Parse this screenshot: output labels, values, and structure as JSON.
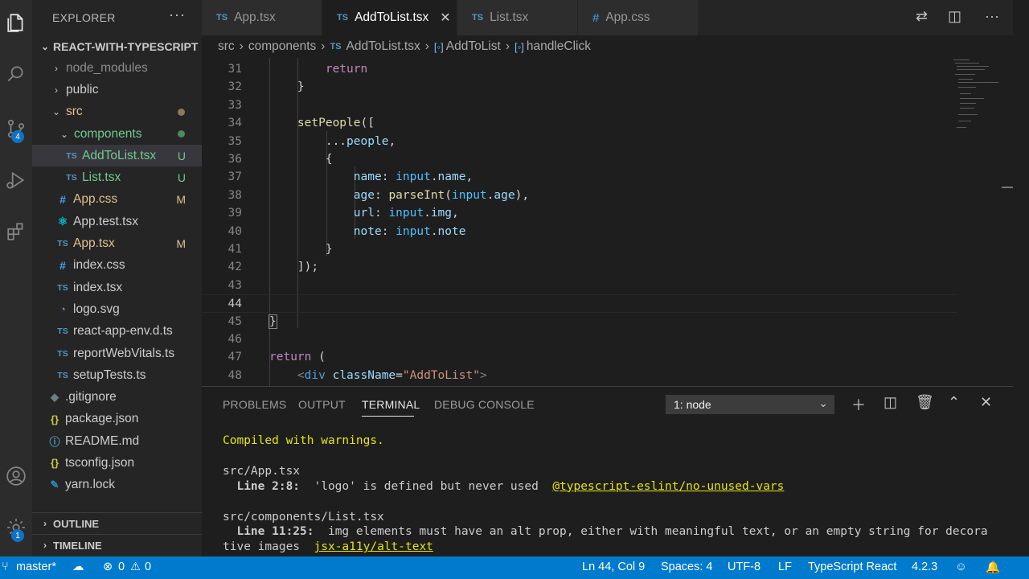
{
  "activity_bar": {
    "scm_badge": "4",
    "settings_badge": "1"
  },
  "sidebar": {
    "title": "EXPLORER",
    "root": "REACT-WITH-TYPESCRIPT",
    "items": [
      {
        "label": "node_modules",
        "icon": "",
        "status": ""
      },
      {
        "label": "public",
        "icon": "",
        "status": ""
      },
      {
        "label": "src",
        "icon": "",
        "status": ""
      },
      {
        "label": "components",
        "icon": "",
        "status": ""
      },
      {
        "label": "AddToList.tsx",
        "icon": "TS",
        "status": "U"
      },
      {
        "label": "List.tsx",
        "icon": "TS",
        "status": "U"
      },
      {
        "label": "App.css",
        "icon": "#",
        "status": "M"
      },
      {
        "label": "App.test.tsx",
        "icon": "⚛",
        "status": ""
      },
      {
        "label": "App.tsx",
        "icon": "TS",
        "status": "M"
      },
      {
        "label": "index.css",
        "icon": "#",
        "status": ""
      },
      {
        "label": "index.tsx",
        "icon": "TS",
        "status": ""
      },
      {
        "label": "logo.svg",
        "icon": "◔",
        "status": ""
      },
      {
        "label": "react-app-env.d.ts",
        "icon": "TS",
        "status": ""
      },
      {
        "label": "reportWebVitals.ts",
        "icon": "TS",
        "status": ""
      },
      {
        "label": "setupTests.ts",
        "icon": "TS",
        "status": ""
      },
      {
        "label": ".gitignore",
        "icon": "◆",
        "status": ""
      },
      {
        "label": "package.json",
        "icon": "{}",
        "status": ""
      },
      {
        "label": "README.md",
        "icon": "ⓘ",
        "status": ""
      },
      {
        "label": "tsconfig.json",
        "icon": "{}",
        "status": ""
      },
      {
        "label": "yarn.lock",
        "icon": "✎",
        "status": ""
      }
    ],
    "outline": "OUTLINE",
    "timeline": "TIMELINE"
  },
  "tabs": [
    {
      "icon": "TS",
      "label": "App.tsx"
    },
    {
      "icon": "TS",
      "label": "AddToList.tsx"
    },
    {
      "icon": "TS",
      "label": "List.tsx"
    },
    {
      "icon": "#",
      "label": "App.css"
    }
  ],
  "breadcrumb": {
    "src": "src",
    "components": "components",
    "file_icon": "TS",
    "file": "AddToList.tsx",
    "symbol_icon": "[◦]",
    "fn1": "AddToList",
    "fn2": "handleClick"
  },
  "editor": {
    "line_numbers": [
      "31",
      "32",
      "33",
      "34",
      "35",
      "36",
      "37",
      "38",
      "39",
      "40",
      "41",
      "42",
      "43",
      "44",
      "45",
      "46",
      "47",
      "48"
    ],
    "current_line": "44"
  },
  "panel": {
    "tabs": [
      "PROBLEMS",
      "OUTPUT",
      "TERMINAL",
      "DEBUG CONSOLE"
    ],
    "terminal_select": "1: node",
    "terminal": {
      "line1": "Compiled with warnings.",
      "file1": "src/App.tsx",
      "w1_loc": "  Line 2:8:",
      "w1_msg": "  'logo' is defined but never used  ",
      "w1_rule": "@typescript-eslint/no-unused-vars",
      "file2": "src/components/List.tsx",
      "w2_loc": "  Line 11:25:",
      "w2_msg": "  img elements must have an alt prop, either with meaningful text, or an empty string for decora",
      "w2_msg_cont": "tive images  ",
      "w2_rule": "jsx-a11y/alt-text"
    }
  },
  "statusbar": {
    "branch": "master*",
    "errors": "0",
    "warnings": "0",
    "position": "Ln 44, Col 9",
    "spaces": "Spaces: 4",
    "encoding": "UTF-8",
    "eol": "LF",
    "language": "TypeScript React",
    "version": "4.2.3"
  }
}
